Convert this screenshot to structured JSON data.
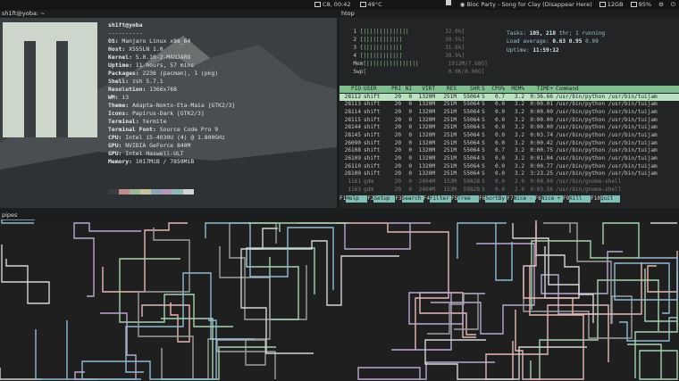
{
  "topbar": {
    "date": "C8, 00:42",
    "temp": "49°C",
    "media": "Bloc Party - Song for Clay (Disappear Here)",
    "storage": "12GB",
    "battery": "95%",
    "menu_icon": "hamburger-icon",
    "workspace_icon": "workspace-icon"
  },
  "panes": {
    "neofetch_title": "sh1ft@yoba: ~",
    "htop_title": "htop",
    "pipes_title": "pipes"
  },
  "neofetch": {
    "user": "sh1ft@yoba",
    "separator": "----------",
    "lines": [
      {
        "key": "OS:",
        "val": "Manjaro Linux x86_64"
      },
      {
        "key": "Host:",
        "val": "X555LN 1.0"
      },
      {
        "key": "Kernel:",
        "val": "5.0.10-2-MANJARO"
      },
      {
        "key": "Uptime:",
        "val": "11 hours, 57 mins"
      },
      {
        "key": "Packages:",
        "val": "2236 (pacman), 1 (pkg)"
      },
      {
        "key": "Shell:",
        "val": "zsh 5.7.1"
      },
      {
        "key": "Resolution:",
        "val": "1366x768"
      },
      {
        "key": "WM:",
        "val": "i3"
      },
      {
        "key": "Theme:",
        "val": "Adapta-Nokto-Eta-Maia [GTK2/3]"
      },
      {
        "key": "Icons:",
        "val": "Papirus-Dark [GTK2/3]"
      },
      {
        "key": "Terminal:",
        "val": "termite"
      },
      {
        "key": "Terminal Font:",
        "val": "Source Code Pro 9"
      },
      {
        "key": "CPU:",
        "val": "Intel i5-4030U (4) @ 1.800GHz"
      },
      {
        "key": "GPU:",
        "val": "NVIDIA GeForce 840M"
      },
      {
        "key": "GPU:",
        "val": "Intel Haswell-ULT"
      },
      {
        "key": "Memory:",
        "val": "1017MiB / 7859MiB"
      }
    ],
    "palette": [
      "#3a3e40",
      "#b98d8b",
      "#9fb89a",
      "#c7c2a0",
      "#8fa4b6",
      "#b59ab6",
      "#8fbcb8",
      "#d4d4d4",
      "#5a5e60",
      "#d6a3a1",
      "#b2d1ad",
      "#e0dbb6",
      "#a5bbcf",
      "#cdb3ce",
      "#a6d4cf",
      "#f0f0f0"
    ],
    "prompt_icon": "flame-icon",
    "prompt_home": "~"
  },
  "htop": {
    "cpus": [
      {
        "n": "1",
        "bar": "[||||||||||||||",
        "pct": "32.0%]"
      },
      {
        "n": "2",
        "bar": "[||||||||||||",
        "pct": "30.5%]"
      },
      {
        "n": "3",
        "bar": "[||||||||||||",
        "pct": "31.6%]"
      },
      {
        "n": "4",
        "bar": "[||||||||||||",
        "pct": "30.9%]"
      }
    ],
    "mem": {
      "label": "Mem",
      "bar": "[||||||||||||||||",
      "val": "1012M/7.68G]"
    },
    "swp": {
      "label": "Swp",
      "bar": "[",
      "val": "0.0K/8.00G]"
    },
    "tasks": "Tasks: ",
    "tasks_val": "105, 218",
    "tasks_rest": " thr; 1 running",
    "load": "Load average: ",
    "load_val": "0.63 0.95",
    "load_rest": " 0.99",
    "uptime": "Uptime: ",
    "uptime_val": "11:59:12",
    "columns": [
      "PID",
      "USER",
      "PRI",
      "NI",
      "VIRT",
      "RES",
      "SHR",
      "S",
      "CPU%",
      "MEM%",
      "TIME+",
      "Command"
    ],
    "processes": [
      [
        "28112",
        "shift",
        "20",
        "0",
        "1320M",
        "251M",
        "55064",
        "S",
        "0.7",
        "3.2",
        "0:36.66",
        "/usr/bin/python /usr/bin/tuijam"
      ],
      [
        "28113",
        "shift",
        "20",
        "0",
        "1320M",
        "251M",
        "55064",
        "S",
        "0.0",
        "3.2",
        "0:00.01",
        "/usr/bin/python /usr/bin/tuijam"
      ],
      [
        "28114",
        "shift",
        "20",
        "0",
        "1320M",
        "251M",
        "55064",
        "S",
        "0.0",
        "3.2",
        "0:00.00",
        "/usr/bin/python /usr/bin/tuijam"
      ],
      [
        "28115",
        "shift",
        "20",
        "0",
        "1320M",
        "251M",
        "55064",
        "S",
        "0.0",
        "3.2",
        "0:00.00",
        "/usr/bin/python /usr/bin/tuijam"
      ],
      [
        "28144",
        "shift",
        "20",
        "0",
        "1320M",
        "251M",
        "55064",
        "S",
        "0.0",
        "3.2",
        "0:00.00",
        "/usr/bin/python /usr/bin/tuijam"
      ],
      [
        "28145",
        "shift",
        "20",
        "0",
        "1320M",
        "251M",
        "55064",
        "S",
        "0.0",
        "3.2",
        "0:03.74",
        "/usr/bin/python /usr/bin/tuijam"
      ],
      [
        "26090",
        "shift",
        "20",
        "0",
        "1320M",
        "251M",
        "55064",
        "S",
        "0.0",
        "3.2",
        "0:00.42",
        "/usr/bin/python /usr/bin/tuijam"
      ],
      [
        "26108",
        "shift",
        "20",
        "0",
        "1320M",
        "251M",
        "55064",
        "S",
        "0.7",
        "3.2",
        "0:00.75",
        "/usr/bin/python /usr/bin/tuijam"
      ],
      [
        "26109",
        "shift",
        "20",
        "0",
        "1320M",
        "251M",
        "55064",
        "S",
        "0.0",
        "3.2",
        "0:01.04",
        "/usr/bin/python /usr/bin/tuijam"
      ],
      [
        "26110",
        "shift",
        "20",
        "0",
        "1320M",
        "251M",
        "55064",
        "S",
        "0.0",
        "3.2",
        "0:00.77",
        "/usr/bin/python /usr/bin/tuijam"
      ],
      [
        "28100",
        "shift",
        "20",
        "0",
        "1320M",
        "251M",
        "55064",
        "S",
        "0.0",
        "3.2",
        "3:23.25",
        "/usr/bin/python /usr/bin/tuijam"
      ],
      [
        "1161",
        "gdm",
        "20",
        "0",
        "2404M",
        "153M",
        "59828",
        "S",
        "0.0",
        "2.0",
        "0:00.00",
        "/usr/bin/gnome-shell"
      ],
      [
        "1163",
        "gdm",
        "20",
        "0",
        "2404M",
        "153M",
        "59828",
        "S",
        "0.0",
        "2.0",
        "0:03.56",
        "/usr/bin/gnome-shell"
      ]
    ],
    "fkeys": [
      {
        "key": "F1",
        "label": "Help"
      },
      {
        "key": "F2",
        "label": "Setup"
      },
      {
        "key": "F3",
        "label": "Search"
      },
      {
        "key": "F4",
        "label": "Filter"
      },
      {
        "key": "F5",
        "label": "Tree"
      },
      {
        "key": "F6",
        "label": "SortBy"
      },
      {
        "key": "F7",
        "label": "Nice -"
      },
      {
        "key": "F8",
        "label": "Nice +"
      },
      {
        "key": "F9",
        "label": "Kill"
      },
      {
        "key": "F10",
        "label": "Quit"
      }
    ]
  },
  "colors": {
    "pipe_colors": [
      "#d5d5d5",
      "#8fbcd0",
      "#e6b8b8",
      "#a7d3b0",
      "#b9a8cf",
      "#9f9f9f"
    ]
  }
}
